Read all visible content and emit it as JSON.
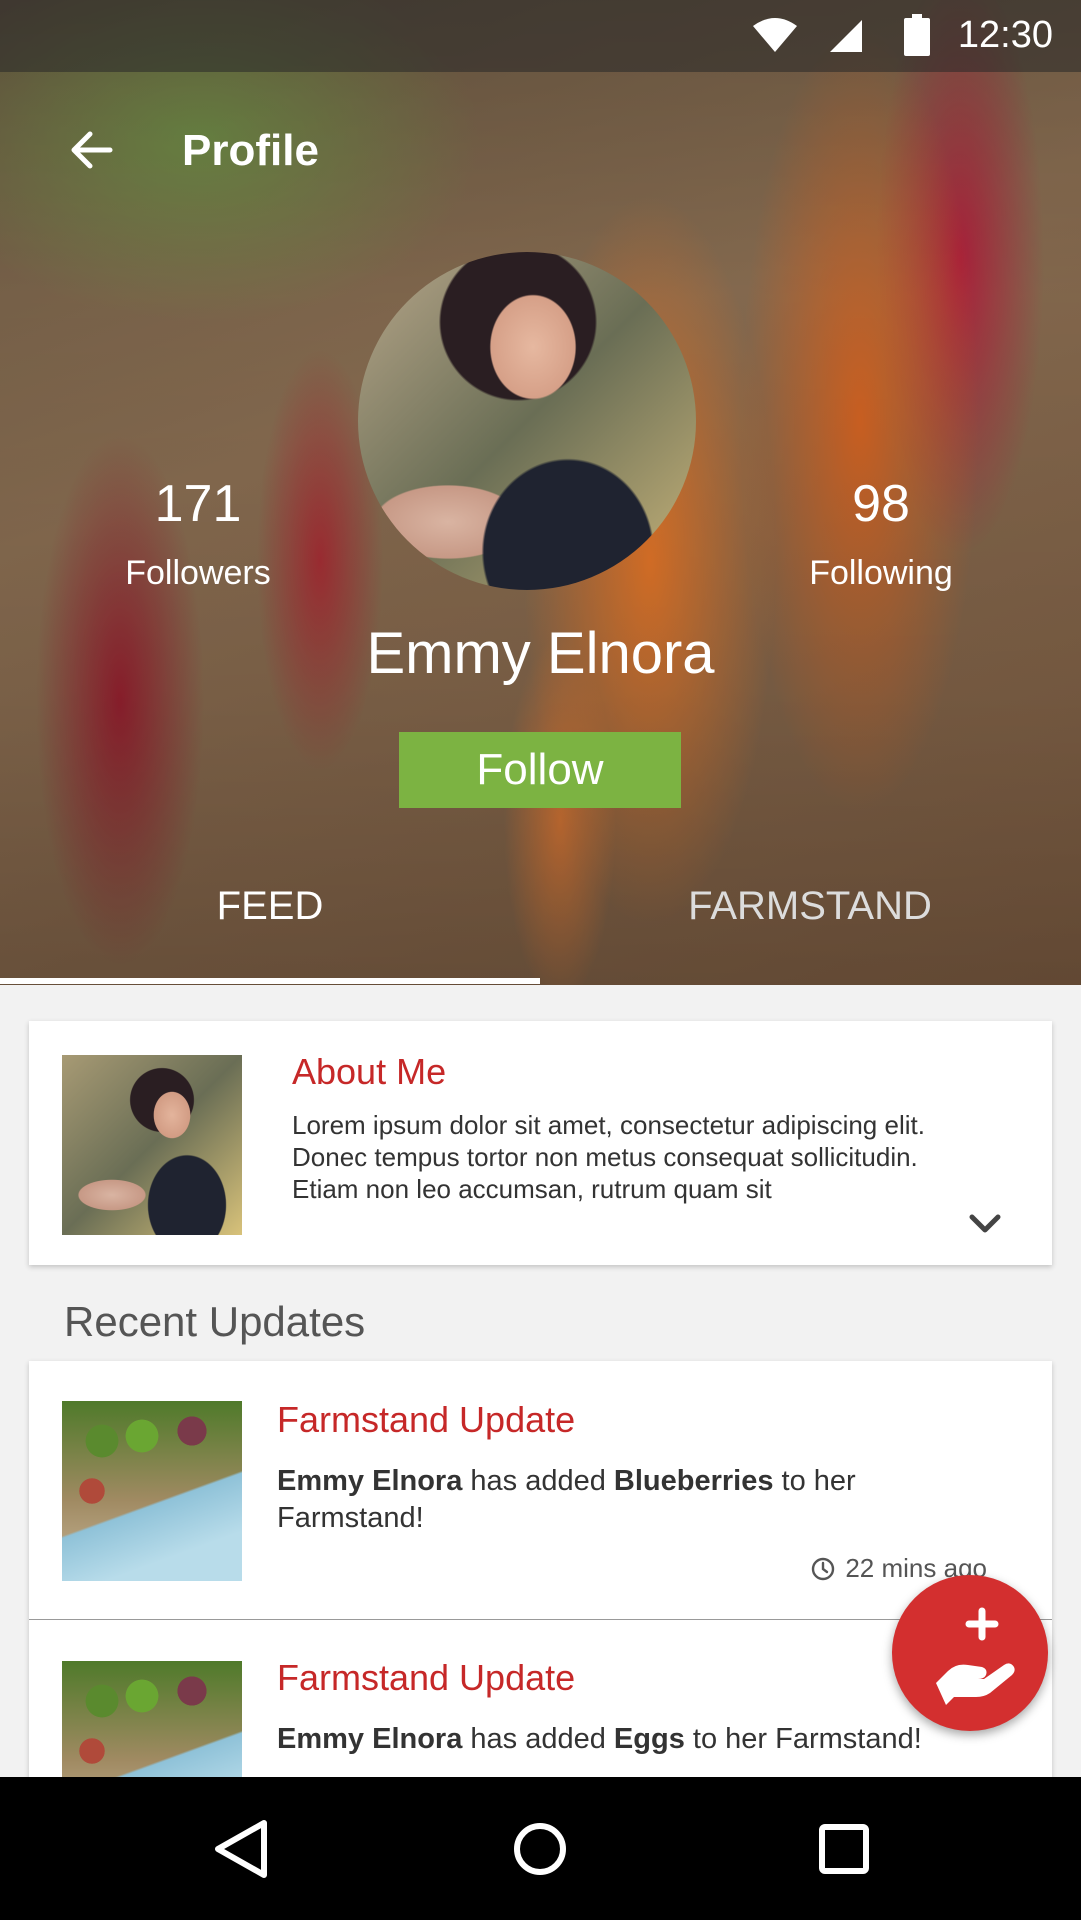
{
  "status_bar": {
    "time": "12:30"
  },
  "header": {
    "title": "Profile"
  },
  "profile": {
    "followers_count": "171",
    "followers_label": "Followers",
    "following_count": "98",
    "following_label": "Following",
    "name": "Emmy Elnora",
    "follow_label": "Follow"
  },
  "tabs": [
    {
      "label": "FEED",
      "active": true
    },
    {
      "label": "FARMSTAND",
      "active": false
    }
  ],
  "about": {
    "title": "About Me",
    "text": "Lorem ipsum dolor sit amet, consectetur adipiscing elit. Donec tempus tortor non metus consequat sollicitudin. Etiam non leo accumsan, rutrum quam sit"
  },
  "recent": {
    "heading": "Recent Updates",
    "items": [
      {
        "title": "Farmstand Update",
        "user": "Emmy Elnora",
        "pre": " has added ",
        "item": "Blueberries",
        "post": " to her Farmstand!",
        "time": "22 mins ago"
      },
      {
        "title": "Farmstand Update",
        "user": "Emmy Elnora",
        "pre": " has added ",
        "item": "Eggs",
        "post": " to her Farmstand!"
      }
    ]
  },
  "colors": {
    "accent_red": "#c62828",
    "follow_green": "#7cb342",
    "fab_red": "#d32f2f"
  },
  "icons": {
    "back": "arrow-left-icon",
    "expand": "chevron-down-icon",
    "fab": "hand-plus-icon",
    "clock": "clock-icon"
  }
}
